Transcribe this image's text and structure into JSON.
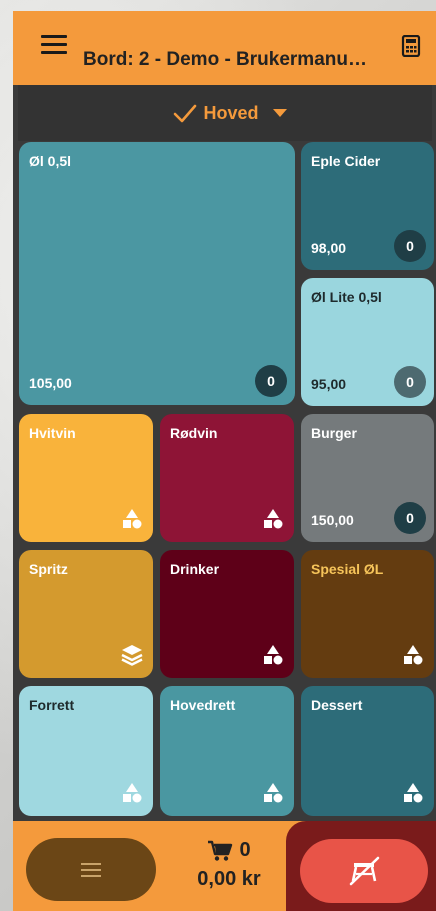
{
  "header": {
    "title": "Bord: 2 - Demo - Brukermanu…"
  },
  "category_selector": {
    "label": "Hoved"
  },
  "tiles": [
    {
      "name": "Øl 0,5l",
      "price": "105,00",
      "count": "0",
      "color": "#4b97a2"
    },
    {
      "name": "Eple Cider",
      "price": "98,00",
      "count": "0",
      "color": "#2d6c79"
    },
    {
      "name": "Øl Lite 0,5l",
      "price": "95,00",
      "count": "0",
      "color": "#9ad6de"
    },
    {
      "name": "Hvitvin",
      "color": "#f9b33b"
    },
    {
      "name": "Rødvin",
      "color": "#8e1436"
    },
    {
      "name": "Burger",
      "price": "150,00",
      "count": "0",
      "color": "#757a7c"
    },
    {
      "name": "Spritz",
      "color": "#d49a2e"
    },
    {
      "name": "Drinker",
      "color": "#5e0018"
    },
    {
      "name": "Spesial ØL",
      "color": "#643c10"
    },
    {
      "name": "Forrett",
      "color": "#9fd8e0"
    },
    {
      "name": "Hovedrett",
      "color": "#4a97a1"
    },
    {
      "name": "Dessert",
      "color": "#2d6c79"
    }
  ],
  "footer": {
    "cart_count": "0",
    "cart_total": "0,00 kr"
  },
  "colors": {
    "accent": "#f49a3c",
    "order_button": "#e85448"
  },
  "icons": {
    "menu": "hamburger-icon",
    "calculator": "calculator-icon",
    "check": "check-icon",
    "dropdown": "caret-down-icon",
    "shapes": "shapes-icon",
    "layers": "layers-icon",
    "cart": "cart-icon",
    "order": "no-serve-icon"
  }
}
